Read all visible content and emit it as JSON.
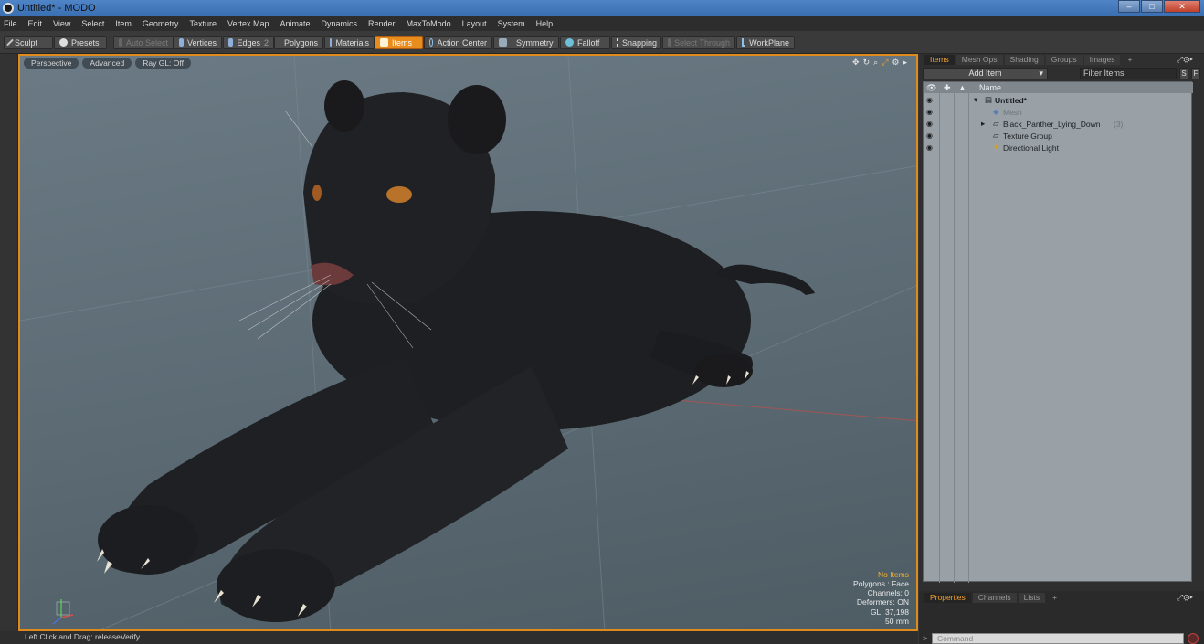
{
  "window": {
    "title": "Untitled* - MODO"
  },
  "menu": [
    "File",
    "Edit",
    "View",
    "Select",
    "Item",
    "Geometry",
    "Texture",
    "Vertex Map",
    "Animate",
    "Dynamics",
    "Render",
    "MaxToModo",
    "Layout",
    "System",
    "Help"
  ],
  "toolbar": {
    "sculpt": "Sculpt",
    "presets": "Presets",
    "auto_select": "Auto Select",
    "vertices": "Vertices",
    "edges": "Edges",
    "edges_count": "2",
    "polygons": "Polygons",
    "materials": "Materials",
    "items": "Items",
    "action_center": "Action Center",
    "symmetry": "Symmetry",
    "falloff": "Falloff",
    "snapping": "Snapping",
    "select_through": "Select Through",
    "workplane": "WorkPlane"
  },
  "viewport": {
    "tabs": [
      "Perspective",
      "Advanced",
      "Ray GL: Off"
    ],
    "stats": {
      "selection": "No Items",
      "polygons": "Polygons : Face",
      "channels": "Channels: 0",
      "deformers": "Deformers: ON",
      "gl": "GL: 37,198",
      "distance": "50 mm"
    }
  },
  "statusbar": {
    "hint": "Left Click and Drag:  releaseVerify"
  },
  "right_panel": {
    "tabs": [
      "Items",
      "Mesh Ops",
      "Shading",
      "Groups",
      "Images"
    ],
    "add_item": "Add Item",
    "filter_placeholder": "Filter Items",
    "s_button": "S",
    "f_button": "F",
    "column_name": "Name",
    "items": [
      {
        "label": "Untitled*",
        "kind": "scene"
      },
      {
        "label": "Mesh",
        "kind": "mesh"
      },
      {
        "label": "Black_Panther_Lying_Down",
        "count": "(3)",
        "kind": "group"
      },
      {
        "label": "Texture Group",
        "kind": "group"
      },
      {
        "label": "Directional Light",
        "kind": "light"
      }
    ]
  },
  "bottom_panel": {
    "tabs": [
      "Properties",
      "Channels",
      "Lists"
    ],
    "command_placeholder": "Command"
  },
  "colors": {
    "accent": "#e88c1e",
    "viewport_bg": "#5f6e77"
  }
}
